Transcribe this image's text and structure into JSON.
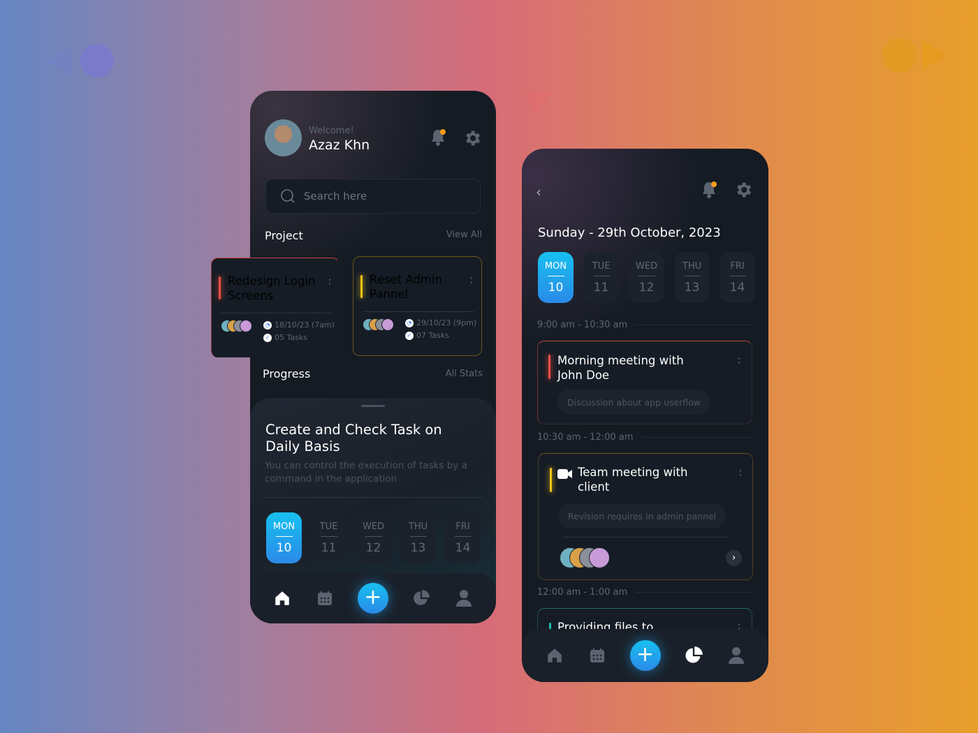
{
  "colors": {
    "accent": "#1fa8ee",
    "red": "#f04f45",
    "yellow": "#f2c318",
    "teal": "#1fbfb0",
    "orange_dot": "#ff9d1a"
  },
  "home": {
    "welcome": "Welcome!",
    "user_name": "Azaz Khn",
    "search_placeholder": "Search here",
    "project_label": "Project",
    "view_all": "View All",
    "projects": [
      {
        "title_line1": "Redesign Login",
        "title_line2": "Screens",
        "date": "18/10/23 (7am)",
        "tasks": "05 Tasks"
      },
      {
        "title_line1": "Reset Admin",
        "title_line2": "Pannel",
        "date": "29/10/23 (9pm)",
        "tasks": "07 Tasks"
      }
    ],
    "progress_label": "Progress",
    "all_stats": "All Stats",
    "sheet_title_line1": "Create and Check Task on",
    "sheet_title_line2": "Daily Basis",
    "sheet_desc_line1": "You can control the execution of tasks by a",
    "sheet_desc_line2": "command in the application",
    "days": [
      {
        "d": "MON",
        "n": "10"
      },
      {
        "d": "TUE",
        "n": "11"
      },
      {
        "d": "WED",
        "n": "12"
      },
      {
        "d": "THU",
        "n": "13"
      },
      {
        "d": "FRI",
        "n": "14"
      }
    ]
  },
  "schedule": {
    "date_title": "Sunday - 29th October, 2023",
    "days": [
      {
        "d": "MON",
        "n": "10"
      },
      {
        "d": "TUE",
        "n": "11"
      },
      {
        "d": "WED",
        "n": "12"
      },
      {
        "d": "THU",
        "n": "13"
      },
      {
        "d": "FRI",
        "n": "14"
      }
    ],
    "slots": [
      {
        "time": "9:00 am - 10:30 am",
        "title_line1": "Morning meeting with",
        "title_line2": "John Doe",
        "note": "Discussion about app userflow"
      },
      {
        "time": "10:30 am - 12:00 am",
        "title_line1": "Team meeting with",
        "title_line2": "client",
        "note": "Revision requires in admin pannel"
      },
      {
        "time": "12:00 am - 1:00 am",
        "title_line1": "Providing files to"
      }
    ]
  }
}
